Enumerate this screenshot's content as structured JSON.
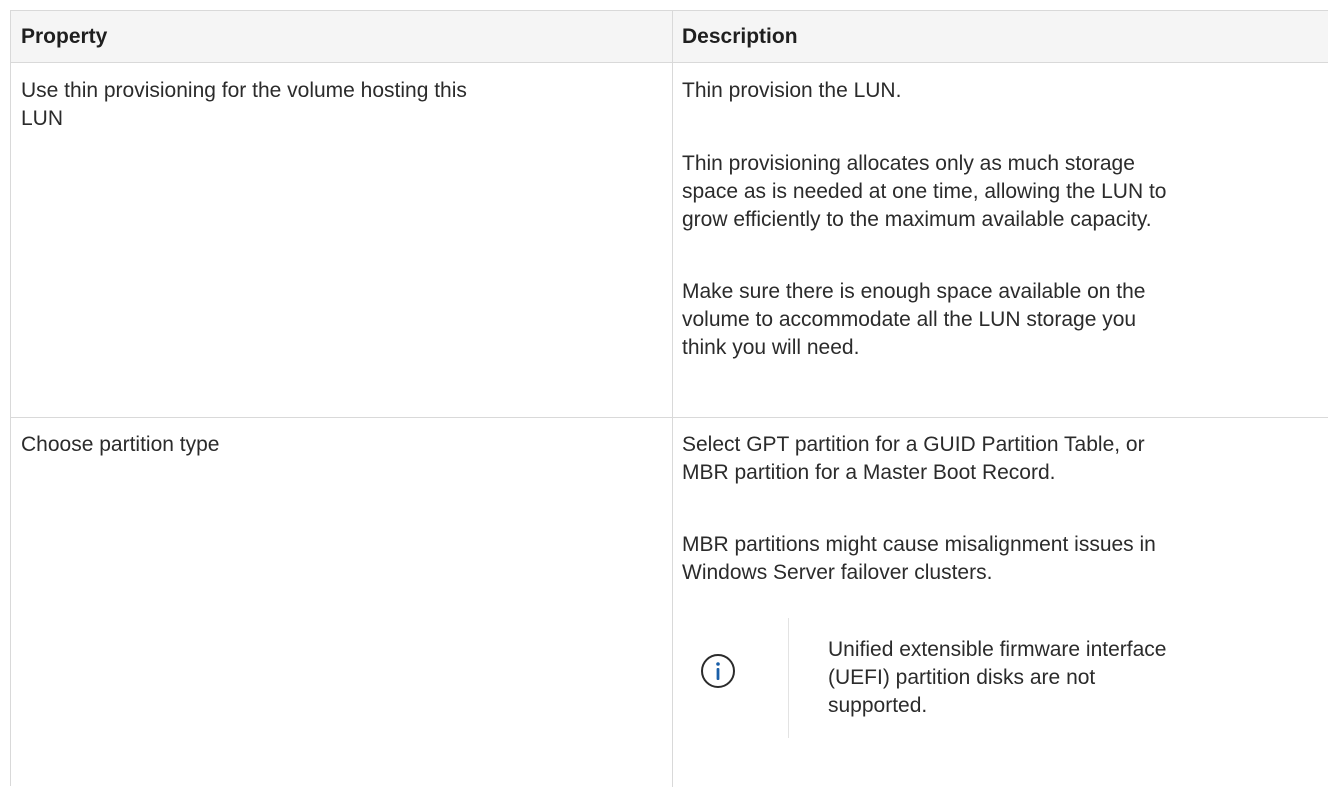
{
  "table": {
    "headers": {
      "property": "Property",
      "description": "Description"
    },
    "rows": [
      {
        "property_lines": [
          "Use thin provisioning for the volume hosting this",
          "LUN"
        ],
        "description": {
          "para1": [
            "Thin provision the LUN."
          ],
          "para2": [
            "Thin provisioning allocates only as much storage",
            "space as is needed at one time, allowing the LUN to",
            "grow efficiently to the maximum available capacity."
          ],
          "para3": [
            "Make sure there is enough space available on the",
            "volume to accommodate all the LUN storage you",
            "think you will need."
          ]
        }
      },
      {
        "property_lines": [
          "Choose partition type"
        ],
        "description": {
          "para1": [
            "Select GPT partition for a GUID Partition Table, or",
            "MBR partition for a Master Boot Record."
          ],
          "para2": [
            "MBR partitions might cause misalignment issues in",
            "Windows Server failover clusters."
          ],
          "note": {
            "icon": "info-icon",
            "icon_color": "#1a5fa8",
            "lines": [
              "Unified extensible firmware interface",
              "(UEFI) partition disks are not",
              "supported."
            ]
          }
        }
      }
    ]
  }
}
